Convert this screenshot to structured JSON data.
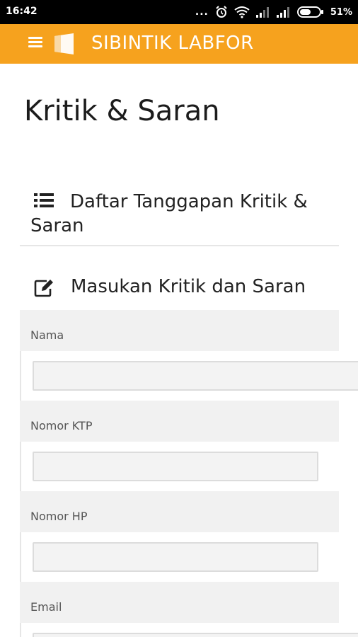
{
  "status_bar": {
    "time": "16:42",
    "dots": "...",
    "battery_percent": "51%"
  },
  "app_bar": {
    "title": "SIBINTIK LABFOR",
    "accent_color": "#f6a21e"
  },
  "page": {
    "title": "Kritik & Saran"
  },
  "sections": {
    "list_label": "Daftar Tanggapan Kritik & Saran",
    "form_label": "Masukan Kritik dan Saran"
  },
  "form": {
    "fields": [
      {
        "label": "Nama",
        "value": ""
      },
      {
        "label": "Nomor KTP",
        "value": ""
      },
      {
        "label": "Nomor HP",
        "value": ""
      },
      {
        "label": "Email",
        "value": ""
      }
    ]
  },
  "icons": {
    "status": [
      "alarm-icon",
      "wifi-icon",
      "signal-icon",
      "signal-icon",
      "battery-icon"
    ],
    "app_bar": [
      "menu-icon",
      "logo-icon"
    ],
    "sections": [
      "list-icon",
      "edit-icon"
    ]
  }
}
